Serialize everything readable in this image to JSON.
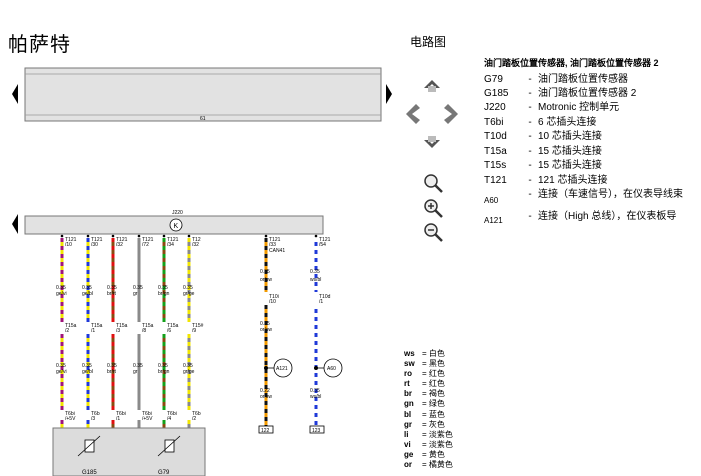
{
  "header": {
    "brand": "帕萨特",
    "doc_type": "电路图"
  },
  "diagram": {
    "top_bar_label": "61",
    "control_unit_label": "J220",
    "control_unit_symbol": "K",
    "pins_top": [
      {
        "c": "T121",
        "n": "/10"
      },
      {
        "c": "T121",
        "n": "/30"
      },
      {
        "c": "T121",
        "n": "/32"
      },
      {
        "c": "T121",
        "n": "/72"
      },
      {
        "c": "T121",
        "n": "/34"
      },
      {
        "c": "T12",
        "n": "/32"
      }
    ],
    "wire_mid": [
      {
        "s": "0.35",
        "c": "ge/vi"
      },
      {
        "s": "0.35",
        "c": "ge/bl"
      },
      {
        "s": "0.35",
        "c": "br/rt"
      },
      {
        "s": "0.35",
        "c": "gr"
      },
      {
        "s": "0.35",
        "c": "br/gn"
      },
      {
        "s": "0.35",
        "c": "gr/ge"
      }
    ],
    "pins_t15": [
      {
        "c": "T15a",
        "n": "/2"
      },
      {
        "c": "T15a",
        "n": "/1"
      },
      {
        "c": "T15a",
        "n": "/3"
      },
      {
        "c": "T15a",
        "n": "/8"
      },
      {
        "c": "T15a",
        "n": "/6"
      },
      {
        "c": "T15#",
        "n": "/9"
      }
    ],
    "wire_low": [
      {
        "s": "0.35",
        "c": "ge/vi"
      },
      {
        "s": "0.35",
        "c": "ge/bl"
      },
      {
        "s": "0.35",
        "c": "br/rt"
      },
      {
        "s": "0.35",
        "c": "gr"
      },
      {
        "s": "0.35",
        "c": "br/gn"
      },
      {
        "s": "0.35",
        "c": "gr/ge"
      }
    ],
    "pins_t6": [
      {
        "c": "T6bi",
        "n": "/+5V"
      },
      {
        "c": "T6b",
        "n": "/3"
      },
      {
        "c": "T6bi",
        "n": "/1"
      },
      {
        "c": "T6bi",
        "n": "/+5V"
      },
      {
        "c": "T6bi",
        "n": "/4"
      },
      {
        "c": "T6b",
        "n": "/2"
      }
    ],
    "sensors": [
      "G185",
      "G79"
    ],
    "right_pins_top": [
      {
        "c": "T121",
        "n": "/33",
        "extra": "CAN41"
      },
      {
        "c": "T121",
        "n": "/54",
        "extra": ""
      }
    ],
    "right_mid": [
      {
        "s": "0.35",
        "c": "or/sw"
      },
      {
        "s": "0.35",
        "c": "ws/bl"
      }
    ],
    "right_pins_t": [
      {
        "c": "T10i",
        "n": "/10"
      },
      {
        "c": "T10d",
        "n": "/1"
      }
    ],
    "right_low1": [
      {
        "s": "0.35",
        "c": "or/sw"
      }
    ],
    "nodes": [
      "A121",
      "A60"
    ],
    "right_low2": [
      {
        "s": "0.22",
        "c": "or/sw"
      },
      {
        "s": "0.35",
        "c": "ws/bl"
      }
    ],
    "refs": [
      "122",
      "123"
    ]
  },
  "legend": {
    "title": "油门踏板位置传感器, 油门踏板位置传感器 2",
    "items": [
      {
        "code": "G79",
        "desc": "油门踏板位置传感器"
      },
      {
        "code": "G185",
        "desc": "油门踏板位置传感器 2"
      },
      {
        "code": "J220",
        "desc": "Motronic 控制单元"
      },
      {
        "code": "T6bi",
        "desc": "6 芯插头连接"
      },
      {
        "code": "T10d",
        "desc": "10 芯插头连接"
      },
      {
        "code": "T15a",
        "desc": "15 芯插头连接"
      },
      {
        "code": "T15s",
        "desc": "15 芯插头连接"
      },
      {
        "code": "T121",
        "desc": "121 芯插头连接"
      },
      {
        "code": "A60",
        "desc": "连接（车速信号），在仪表导线束"
      },
      {
        "code": "A121",
        "desc": "连接（High 总线），在仪表板导"
      }
    ]
  },
  "color_codes": [
    {
      "k": "ws",
      "v": "白色"
    },
    {
      "k": "sw",
      "v": "黑色"
    },
    {
      "k": "ro",
      "v": "红色"
    },
    {
      "k": "rt",
      "v": "红色"
    },
    {
      "k": "br",
      "v": "褐色"
    },
    {
      "k": "gn",
      "v": "绿色"
    },
    {
      "k": "bl",
      "v": "蓝色"
    },
    {
      "k": "gr",
      "v": "灰色"
    },
    {
      "k": "li",
      "v": "淡紫色"
    },
    {
      "k": "vi",
      "v": "淡紫色"
    },
    {
      "k": "ge",
      "v": "黄色"
    },
    {
      "k": "or",
      "v": "橘黄色"
    }
  ],
  "colors": {
    "bar_fill": "#e2e2e2",
    "ge": "#f2e600",
    "vi": "#a0147a",
    "bl": "#1f39d8",
    "br": "#8a4a10",
    "rt": "#e01010",
    "gr": "#8a8a8a",
    "gn": "#13a01a",
    "sw": "#111111",
    "or": "#f29a00",
    "ws": "#ffffff"
  },
  "icons": {
    "nav_up": "chevron-up-icon",
    "nav_left": "chevron-left-icon",
    "nav_right": "chevron-right-icon",
    "nav_down": "chevron-down-icon",
    "zoom_in": "zoom-in-icon",
    "zoom_out": "zoom-out-icon",
    "zoom_fit": "zoom-fit-icon"
  }
}
